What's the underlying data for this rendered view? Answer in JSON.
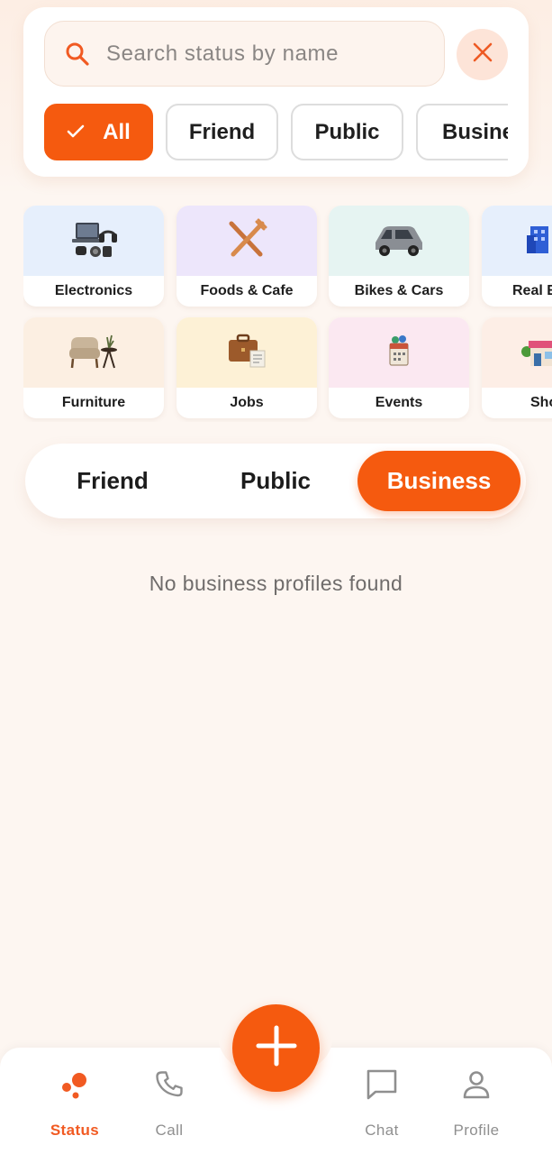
{
  "search": {
    "placeholder": "Search status by name",
    "icon": "search-icon",
    "clear_icon": "close-icon"
  },
  "filter_chips": [
    {
      "label": "All",
      "selected": true,
      "icon": "check-icon"
    },
    {
      "label": "Friend",
      "selected": false
    },
    {
      "label": "Public",
      "selected": false
    },
    {
      "label": "Busine",
      "selected": false
    }
  ],
  "categories": [
    {
      "label": "Electronics",
      "icon": "electronics-icon",
      "bg": "#e6effc"
    },
    {
      "label": "Foods & Cafe",
      "icon": "fork-knife-icon",
      "bg": "#ede6fb"
    },
    {
      "label": "Bikes & Cars",
      "icon": "car-icon",
      "bg": "#e6f4f2"
    },
    {
      "label": "Real E",
      "icon": "building-icon",
      "bg": "#e6effc"
    },
    {
      "label": "Furniture",
      "icon": "armchair-icon",
      "bg": "#fcefe2"
    },
    {
      "label": "Jobs",
      "icon": "briefcase-icon",
      "bg": "#fdf1d6"
    },
    {
      "label": "Events",
      "icon": "calendar-icon",
      "bg": "#fbe8f1"
    },
    {
      "label": "Sho",
      "icon": "shop-icon",
      "bg": "#fdeee6"
    }
  ],
  "segmented": {
    "options": [
      "Friend",
      "Public",
      "Business"
    ],
    "selected": "Business"
  },
  "empty_message": "No business profiles found",
  "nav": {
    "items": [
      {
        "label": "Status",
        "icon": "status-icon",
        "active": true
      },
      {
        "label": "Call",
        "icon": "phone-icon",
        "active": false
      },
      {
        "label": "Chat",
        "icon": "chat-icon",
        "active": false
      },
      {
        "label": "Profile",
        "icon": "profile-icon",
        "active": false
      }
    ],
    "fab_icon": "plus-icon"
  },
  "colors": {
    "accent": "#f55a0f",
    "background": "#fdf6f1"
  }
}
